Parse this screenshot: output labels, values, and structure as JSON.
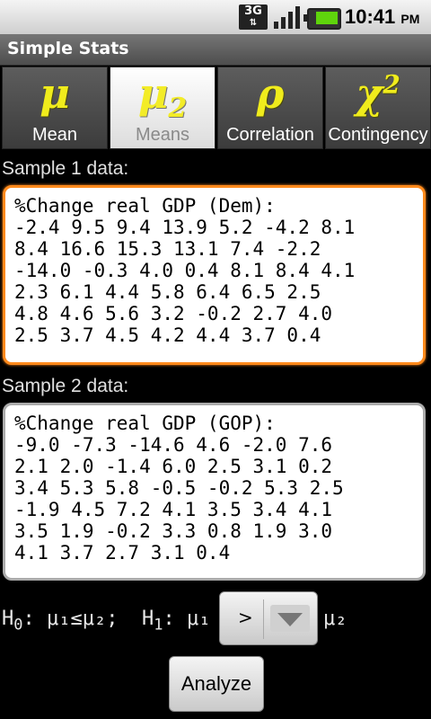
{
  "status_bar": {
    "network": "3G",
    "time": "10:41",
    "ampm": "PM",
    "battery_color": "#5fd40c"
  },
  "app": {
    "title": "Simple Stats"
  },
  "tabs": [
    {
      "symbol": "μ",
      "label": "Mean",
      "selected": false
    },
    {
      "symbol": "μ",
      "symbol_sub": "2",
      "label": "Means",
      "selected": true
    },
    {
      "symbol": "ρ",
      "label": "Correlation",
      "selected": false
    },
    {
      "symbol": "χ",
      "symbol_sup": "2",
      "label": "Contingency",
      "selected": false
    }
  ],
  "sample1": {
    "label": "Sample 1 data:",
    "text": "%Change real GDP (Dem):\n-2.4 9.5 9.4 13.9 5.2 -4.2 8.1\n8.4 16.6 15.3 13.1 7.4 -2.2\n-14.0 -0.3 4.0 0.4 8.1 8.4 4.1\n2.3 6.1 4.4 5.8 6.4 6.5 2.5\n4.8 4.6 5.6 3.2 -0.2 2.7 4.0\n2.5 3.7 4.5 4.2 4.4 3.7 0.4"
  },
  "sample2": {
    "label": "Sample 2 data:",
    "text": "%Change real GDP (GOP):\n-9.0 -7.3 -14.6 4.6 -2.0 7.6\n2.1 2.0 -1.4 6.0 2.5 3.1 0.2\n3.4 5.3 5.8 -0.5 -0.2 5.3 2.5\n-1.9 4.5 7.2 4.1 3.5 3.4 4.1\n3.5 1.9 -0.2 3.3 0.8 1.9 3.0\n4.1 3.7 2.7 3.1 0.4"
  },
  "hypothesis": {
    "h0_label": "H",
    "h0_sub": "0",
    "h0_expr": ": μ₁≤μ₂;",
    "h1_label": "H",
    "h1_sub": "1",
    "h1_expr": ": μ₁",
    "operator": ">",
    "rhs": "μ₂"
  },
  "buttons": {
    "analyze": "Analyze"
  },
  "accent_color": "#ff8a1c"
}
